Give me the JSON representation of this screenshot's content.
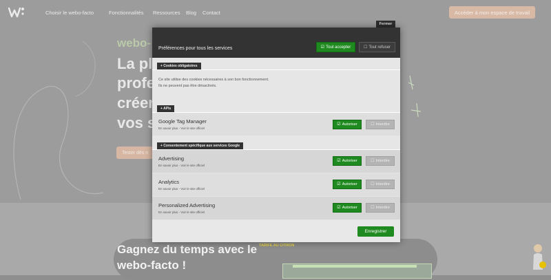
{
  "background": {
    "nav": {
      "items": [
        "Choisir le webo-facto",
        "Fonctionnalités",
        "Ressources",
        "Blog",
        "Contact"
      ],
      "cta": "Accéder à mon espace de travail"
    },
    "hero": {
      "brand": "webo-",
      "lines": [
        "La pl",
        "profe",
        "créer",
        "vos s"
      ],
      "button": "Tester dès n"
    },
    "lower": {
      "title_lines": [
        "Gagnez du temps avec le",
        "webo-facto !"
      ],
      "tag": "TARIFE AU CITRON"
    }
  },
  "modal": {
    "close_label": "Fermer",
    "title": "Préférences pour tous les services",
    "accept_all": "Tout accepter",
    "refuse_all": "Tout refuser",
    "sections": {
      "mandatory": {
        "label": "+ Cookies obligatoires",
        "text_line1": "Ce site utilise des cookies nécessaires à son bon fonctionnement.",
        "text_line2": "Ils ne peuvent pas être désactivés."
      },
      "apis": {
        "label": "+ APIs"
      },
      "google": {
        "label": "+ Consentement spécifique aux services Google"
      }
    },
    "services": [
      {
        "name": "Google Tag Manager",
        "links": "En savoir plus - Voir le site officiel",
        "allow": "Autoriser",
        "deny": "Interdire",
        "allowed": true
      },
      {
        "name": "Advertising",
        "links": "En savoir plus - Voir le site officiel",
        "allow": "Autoriser",
        "deny": "Interdire",
        "allowed": true
      },
      {
        "name": "Analytics",
        "links": "En savoir plus - Voir le site officiel",
        "allow": "Autoriser",
        "deny": "Interdire",
        "allowed": true
      },
      {
        "name": "Personalized Advertising",
        "links": "En savoir plus - Voir le site officiel",
        "allow": "Autoriser",
        "deny": "Interdire",
        "allowed": true
      }
    ],
    "save": "Enregistrer",
    "icons": {
      "checked": "checkbox-checked-icon",
      "unchecked": "checkbox-empty-icon"
    },
    "colors": {
      "accent": "#1f8a1f",
      "header": "#333333",
      "deny": "#b4b4b4"
    }
  }
}
